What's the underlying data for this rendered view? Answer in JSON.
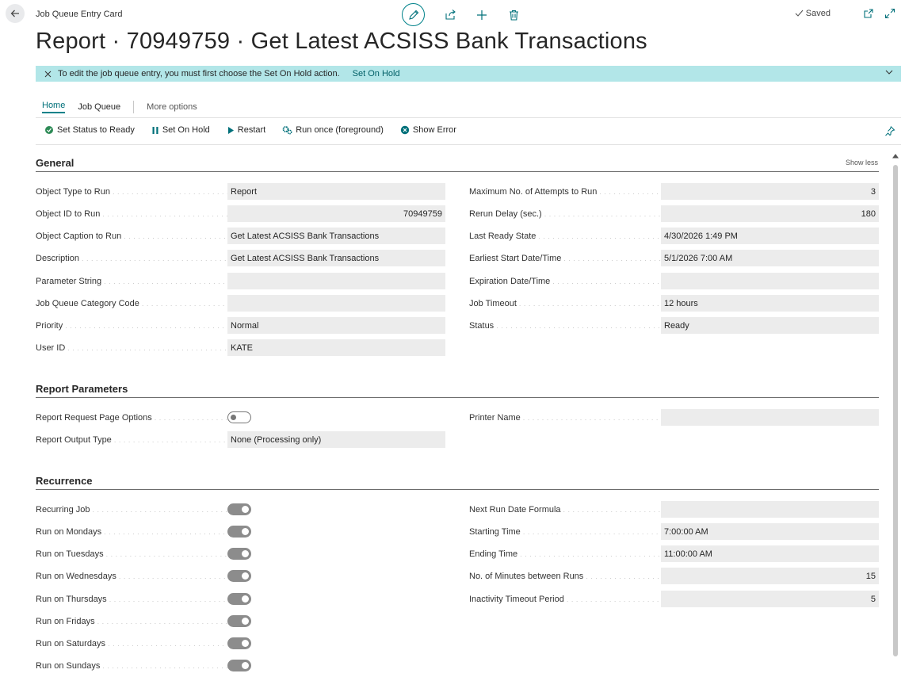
{
  "header": {
    "caption": "Job Queue Entry Card",
    "title": "Report · 70949759 · Get Latest ACSISS Bank Transactions",
    "saved_label": "Saved"
  },
  "banner": {
    "message": "To edit the job queue entry, you must first choose the Set On Hold action.",
    "link": "Set On Hold"
  },
  "tabs": {
    "home": "Home",
    "job_queue": "Job Queue",
    "more_options": "More options"
  },
  "actions": {
    "set_status_ready": "Set Status to Ready",
    "set_on_hold": "Set On Hold",
    "restart": "Restart",
    "run_once": "Run once (foreground)",
    "show_error": "Show Error"
  },
  "general": {
    "title": "General",
    "show_less": "Show less",
    "left": [
      {
        "label": "Object Type to Run",
        "value": "Report"
      },
      {
        "label": "Object ID to Run",
        "value": "70949759"
      },
      {
        "label": "Object Caption to Run",
        "value": "Get Latest ACSISS Bank Transactions"
      },
      {
        "label": "Description",
        "value": "Get Latest ACSISS Bank Transactions"
      },
      {
        "label": "Parameter String",
        "value": ""
      },
      {
        "label": "Job Queue Category Code",
        "value": ""
      },
      {
        "label": "Priority",
        "value": "Normal"
      },
      {
        "label": "User ID",
        "value": "KATE"
      }
    ],
    "right": [
      {
        "label": "Maximum No. of Attempts to Run",
        "value": "3"
      },
      {
        "label": "Rerun Delay (sec.)",
        "value": "180"
      },
      {
        "label": "Last Ready State",
        "value": "4/30/2026 1:49 PM"
      },
      {
        "label": "Earliest Start Date/Time",
        "value": "5/1/2026 7:00 AM"
      },
      {
        "label": "Expiration Date/Time",
        "value": ""
      },
      {
        "label": "Job Timeout",
        "value": "12 hours"
      },
      {
        "label": "Status",
        "value": "Ready"
      }
    ]
  },
  "report_parameters": {
    "title": "Report Parameters",
    "request_page_options_label": "Report Request Page Options",
    "request_page_options_on": false,
    "output_type_label": "Report Output Type",
    "output_type_value": "None (Processing only)",
    "printer_name_label": "Printer Name",
    "printer_name_value": ""
  },
  "recurrence": {
    "title": "Recurrence",
    "left": [
      {
        "label": "Recurring Job",
        "on": true
      },
      {
        "label": "Run on Mondays",
        "on": true
      },
      {
        "label": "Run on Tuesdays",
        "on": true
      },
      {
        "label": "Run on Wednesdays",
        "on": true
      },
      {
        "label": "Run on Thursdays",
        "on": true
      },
      {
        "label": "Run on Fridays",
        "on": true
      },
      {
        "label": "Run on Saturdays",
        "on": true
      },
      {
        "label": "Run on Sundays",
        "on": true
      }
    ],
    "right": [
      {
        "label": "Next Run Date Formula",
        "value": ""
      },
      {
        "label": "Starting Time",
        "value": "7:00:00 AM"
      },
      {
        "label": "Ending Time",
        "value": "11:00:00 AM"
      },
      {
        "label": "No. of Minutes between Runs",
        "value": "15"
      },
      {
        "label": "Inactivity Timeout Period",
        "value": "5"
      }
    ]
  },
  "colors": {
    "accent": "#00828a",
    "banner_bg": "#b2e6e8",
    "field_bg": "#ececec"
  }
}
